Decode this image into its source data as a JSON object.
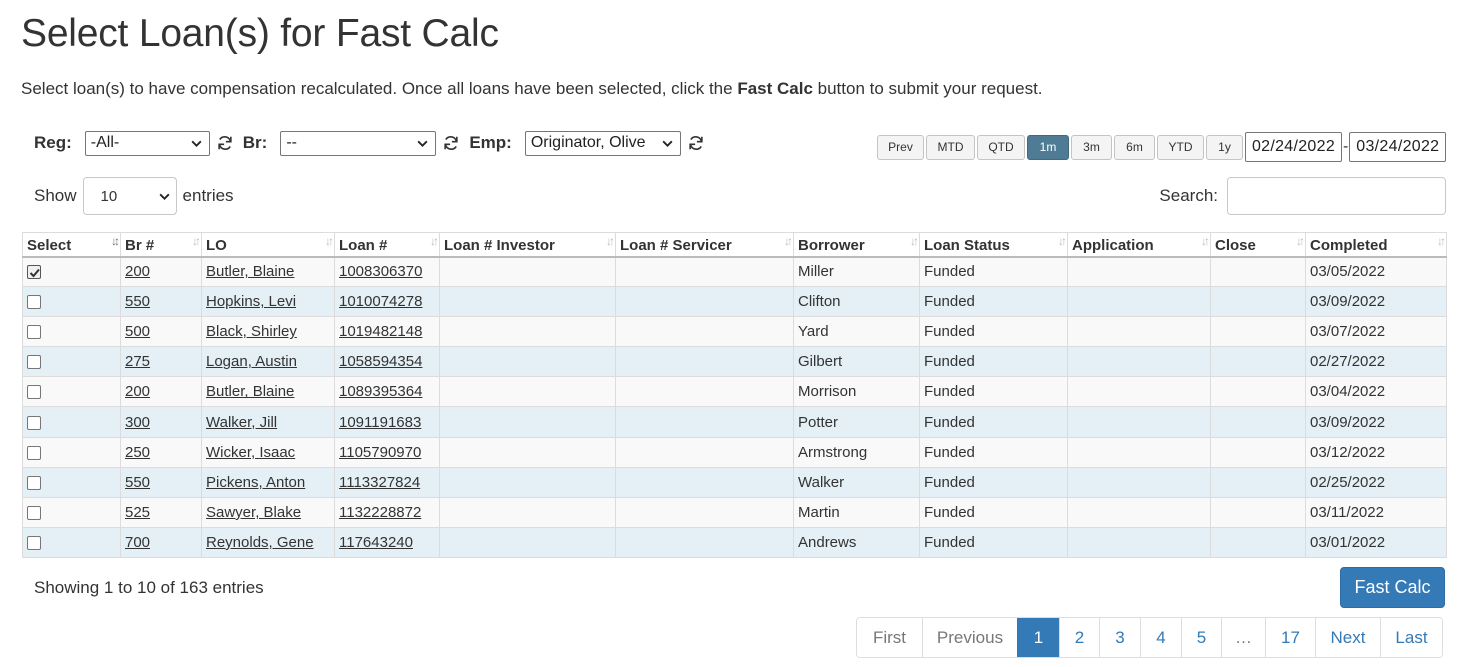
{
  "page": {
    "title": "Select Loan(s) for Fast Calc",
    "intro_before": "Select loan(s) to have compensation recalculated. Once all loans have been selected, click the ",
    "intro_bold": "Fast Calc",
    "intro_after": " button to submit your request."
  },
  "filters": {
    "reg_label": "Reg:",
    "reg_value": "-All-",
    "br_label": "Br:",
    "br_value": "--",
    "emp_label": "Emp:",
    "emp_value": "Originator, Olive"
  },
  "date_range": {
    "buttons": [
      "Prev",
      "MTD",
      "QTD",
      "1m",
      "3m",
      "6m",
      "YTD",
      "1y"
    ],
    "active": "1m",
    "start": "02/24/2022",
    "separator": "-",
    "end": "03/24/2022"
  },
  "table_controls": {
    "show_label": "Show",
    "page_length": "10",
    "entries_label": "entries",
    "search_label": "Search:",
    "search_value": ""
  },
  "table": {
    "columns": [
      "Select",
      "Br #",
      "LO",
      "Loan #",
      "Loan # Investor",
      "Loan # Servicer",
      "Borrower",
      "Loan Status",
      "Application",
      "Close",
      "Completed"
    ],
    "sorted_column": "Select",
    "rows": [
      {
        "selected": true,
        "br": "200",
        "lo": "Butler, Blaine",
        "loan": "1008306370",
        "investor": "",
        "servicer": "",
        "borrower": "Miller",
        "status": "Funded",
        "application": "",
        "close": "",
        "completed": "03/05/2022"
      },
      {
        "selected": false,
        "br": "550",
        "lo": "Hopkins, Levi",
        "loan": "1010074278",
        "investor": "",
        "servicer": "",
        "borrower": "Clifton",
        "status": "Funded",
        "application": "",
        "close": "",
        "completed": "03/09/2022"
      },
      {
        "selected": false,
        "br": "500",
        "lo": "Black, Shirley",
        "loan": "1019482148",
        "investor": "",
        "servicer": "",
        "borrower": "Yard",
        "status": "Funded",
        "application": "",
        "close": "",
        "completed": "03/07/2022"
      },
      {
        "selected": false,
        "br": "275",
        "lo": "Logan, Austin",
        "loan": "1058594354",
        "investor": "",
        "servicer": "",
        "borrower": "Gilbert",
        "status": "Funded",
        "application": "",
        "close": "",
        "completed": "02/27/2022"
      },
      {
        "selected": false,
        "br": "200",
        "lo": "Butler, Blaine",
        "loan": "1089395364",
        "investor": "",
        "servicer": "",
        "borrower": "Morrison",
        "status": "Funded",
        "application": "",
        "close": "",
        "completed": "03/04/2022"
      },
      {
        "selected": false,
        "br": "300",
        "lo": "Walker, Jill",
        "loan": "1091191683",
        "investor": "",
        "servicer": "",
        "borrower": "Potter",
        "status": "Funded",
        "application": "",
        "close": "",
        "completed": "03/09/2022"
      },
      {
        "selected": false,
        "br": "250",
        "lo": "Wicker, Isaac",
        "loan": "1105790970",
        "investor": "",
        "servicer": "",
        "borrower": "Armstrong",
        "status": "Funded",
        "application": "",
        "close": "",
        "completed": "03/12/2022"
      },
      {
        "selected": false,
        "br": "550",
        "lo": "Pickens, Anton",
        "loan": "1113327824",
        "investor": "",
        "servicer": "",
        "borrower": "Walker",
        "status": "Funded",
        "application": "",
        "close": "",
        "completed": "02/25/2022"
      },
      {
        "selected": false,
        "br": "525",
        "lo": "Sawyer, Blake",
        "loan": "1132228872",
        "investor": "",
        "servicer": "",
        "borrower": "Martin",
        "status": "Funded",
        "application": "",
        "close": "",
        "completed": "03/11/2022"
      },
      {
        "selected": false,
        "br": "700",
        "lo": "Reynolds, Gene",
        "loan": "117643240",
        "investor": "",
        "servicer": "",
        "borrower": "Andrews",
        "status": "Funded",
        "application": "",
        "close": "",
        "completed": "03/01/2022"
      }
    ]
  },
  "footer": {
    "info": "Showing 1 to 10 of 163 entries",
    "fast_calc_label": "Fast Calc"
  },
  "pagination": {
    "items": [
      "First",
      "Previous",
      "1",
      "2",
      "3",
      "4",
      "5",
      "…",
      "17",
      "Next",
      "Last"
    ],
    "current": "1",
    "disabled": [
      "First",
      "Previous",
      "…"
    ]
  },
  "colors": {
    "primary": "#337ab7",
    "active_range": "#4f7b94",
    "row_alt": "#e4f0f6"
  },
  "icons": [
    "refresh-icon",
    "chevron-down-icon",
    "sort-icon",
    "check-icon"
  ]
}
